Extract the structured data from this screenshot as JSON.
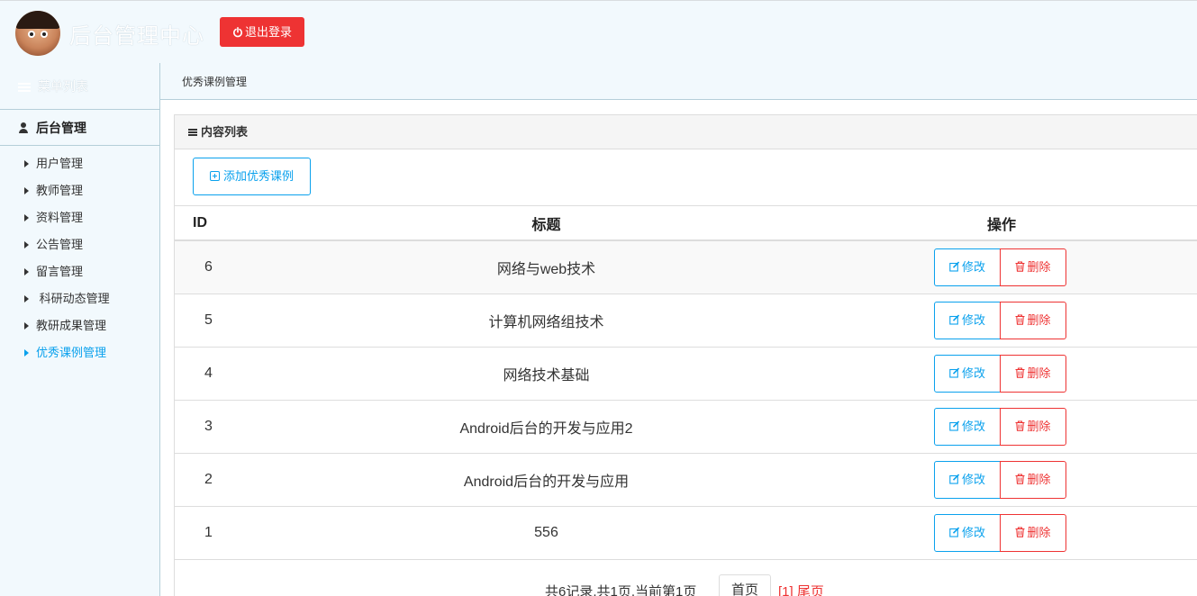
{
  "header": {
    "brand": "后台管理中心",
    "logout_label": "退出登录"
  },
  "sidebar": {
    "title": "菜单列表",
    "group": "后台管理",
    "items": [
      {
        "label": "用户管理"
      },
      {
        "label": "教师管理"
      },
      {
        "label": "资料管理"
      },
      {
        "label": "公告管理"
      },
      {
        "label": "留言管理"
      },
      {
        "label": " 科研动态管理"
      },
      {
        "label": "教研成果管理"
      },
      {
        "label": "优秀课例管理"
      }
    ],
    "active_index": 7
  },
  "breadcrumb": "优秀课例管理",
  "panel": {
    "title": "内容列表",
    "add_label": "添加优秀课例"
  },
  "table": {
    "headers": {
      "id": "ID",
      "title": "标题",
      "ops": "操作"
    },
    "edit_label": "修改",
    "delete_label": "删除",
    "rows": [
      {
        "id": "6",
        "title": "网络与web技术"
      },
      {
        "id": "5",
        "title": "计算机网络组技术"
      },
      {
        "id": "4",
        "title": "网络技术基础"
      },
      {
        "id": "3",
        "title": "Android后台的开发与应用2"
      },
      {
        "id": "2",
        "title": "Android后台的开发与应用"
      },
      {
        "id": "1",
        "title": "556"
      }
    ]
  },
  "pager": {
    "info": "共6记录,共1页,当前第1页",
    "first_label": "首页",
    "current": "[1] 尾页"
  },
  "colors": {
    "accent": "#0aa1ed",
    "danger": "#ee3333",
    "background": "#f2f9fd"
  }
}
